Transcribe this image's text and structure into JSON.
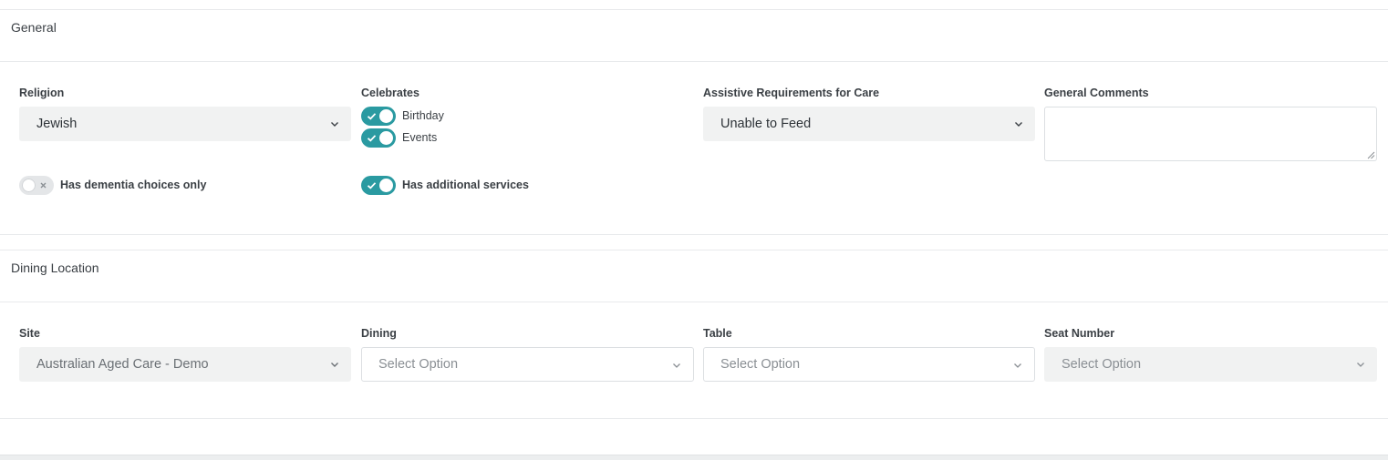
{
  "general": {
    "title": "General",
    "religion": {
      "label": "Religion",
      "value": "Jewish"
    },
    "celebrates": {
      "label": "Celebrates",
      "options": [
        {
          "label": "Birthday",
          "checked": true
        },
        {
          "label": "Events",
          "checked": true
        }
      ]
    },
    "assistive": {
      "label": "Assistive Requirements for Care",
      "value": "Unable to Feed"
    },
    "comments": {
      "label": "General Comments",
      "value": ""
    },
    "dementia_toggle": {
      "label": "Has dementia choices only",
      "checked": false
    },
    "additional_services_toggle": {
      "label": "Has additional services",
      "checked": true
    }
  },
  "dining_location": {
    "title": "Dining Location",
    "site": {
      "label": "Site",
      "value": "Australian Aged Care - Demo"
    },
    "dining": {
      "label": "Dining",
      "placeholder": "Select Option"
    },
    "table": {
      "label": "Table",
      "placeholder": "Select Option"
    },
    "seat_number": {
      "label": "Seat Number",
      "placeholder": "Select Option"
    }
  },
  "colors": {
    "accent": "#2a9aa1",
    "field_bg": "#f1f2f2",
    "border": "#dcdfe2"
  },
  "icons": [
    "chevron-down-icon",
    "check-icon",
    "x-icon",
    "resize-grip-icon"
  ]
}
